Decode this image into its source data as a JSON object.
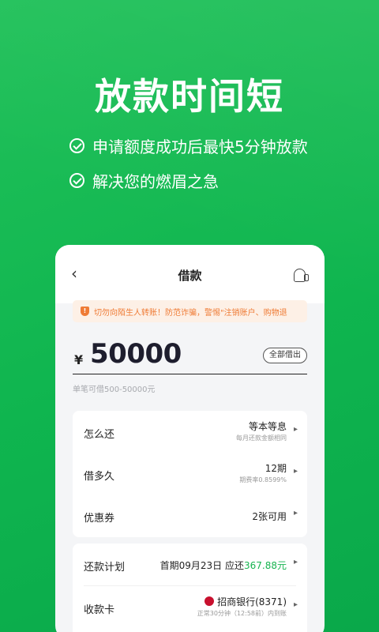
{
  "hero": {
    "title": "放款时间短",
    "features": [
      "申请额度成功后最快5分钟放款",
      "解决您的燃眉之急"
    ]
  },
  "app": {
    "nav": {
      "back_icon": "‹",
      "title": "借款",
      "service_icon": "headset-icon"
    },
    "warning": "切勿向陌生人转账！防范诈骗，警惕\"注销账户、购物退",
    "amount": {
      "currency": "¥",
      "value": "50000",
      "all_button": "全部借出",
      "hint": "单笔可借500-50000元"
    },
    "options": [
      {
        "label": "怎么还",
        "value": "等本等息",
        "sub": "每月还款金额相同"
      },
      {
        "label": "借多久",
        "value": "12期",
        "sub": "期费率0.8599%"
      },
      {
        "label": "优惠券",
        "value": "2张可用",
        "sub": ""
      }
    ],
    "plan": {
      "label": "还款计划",
      "value_prefix": "首期09月23日 应还",
      "value_amount": "367.88元"
    },
    "card": {
      "label": "收款卡",
      "value": "招商银行(8371)",
      "sub": "正常30分钟（12:58前）内到账"
    }
  },
  "colors": {
    "brand_green": "#17b450",
    "warning_orange": "#ef7b35"
  }
}
